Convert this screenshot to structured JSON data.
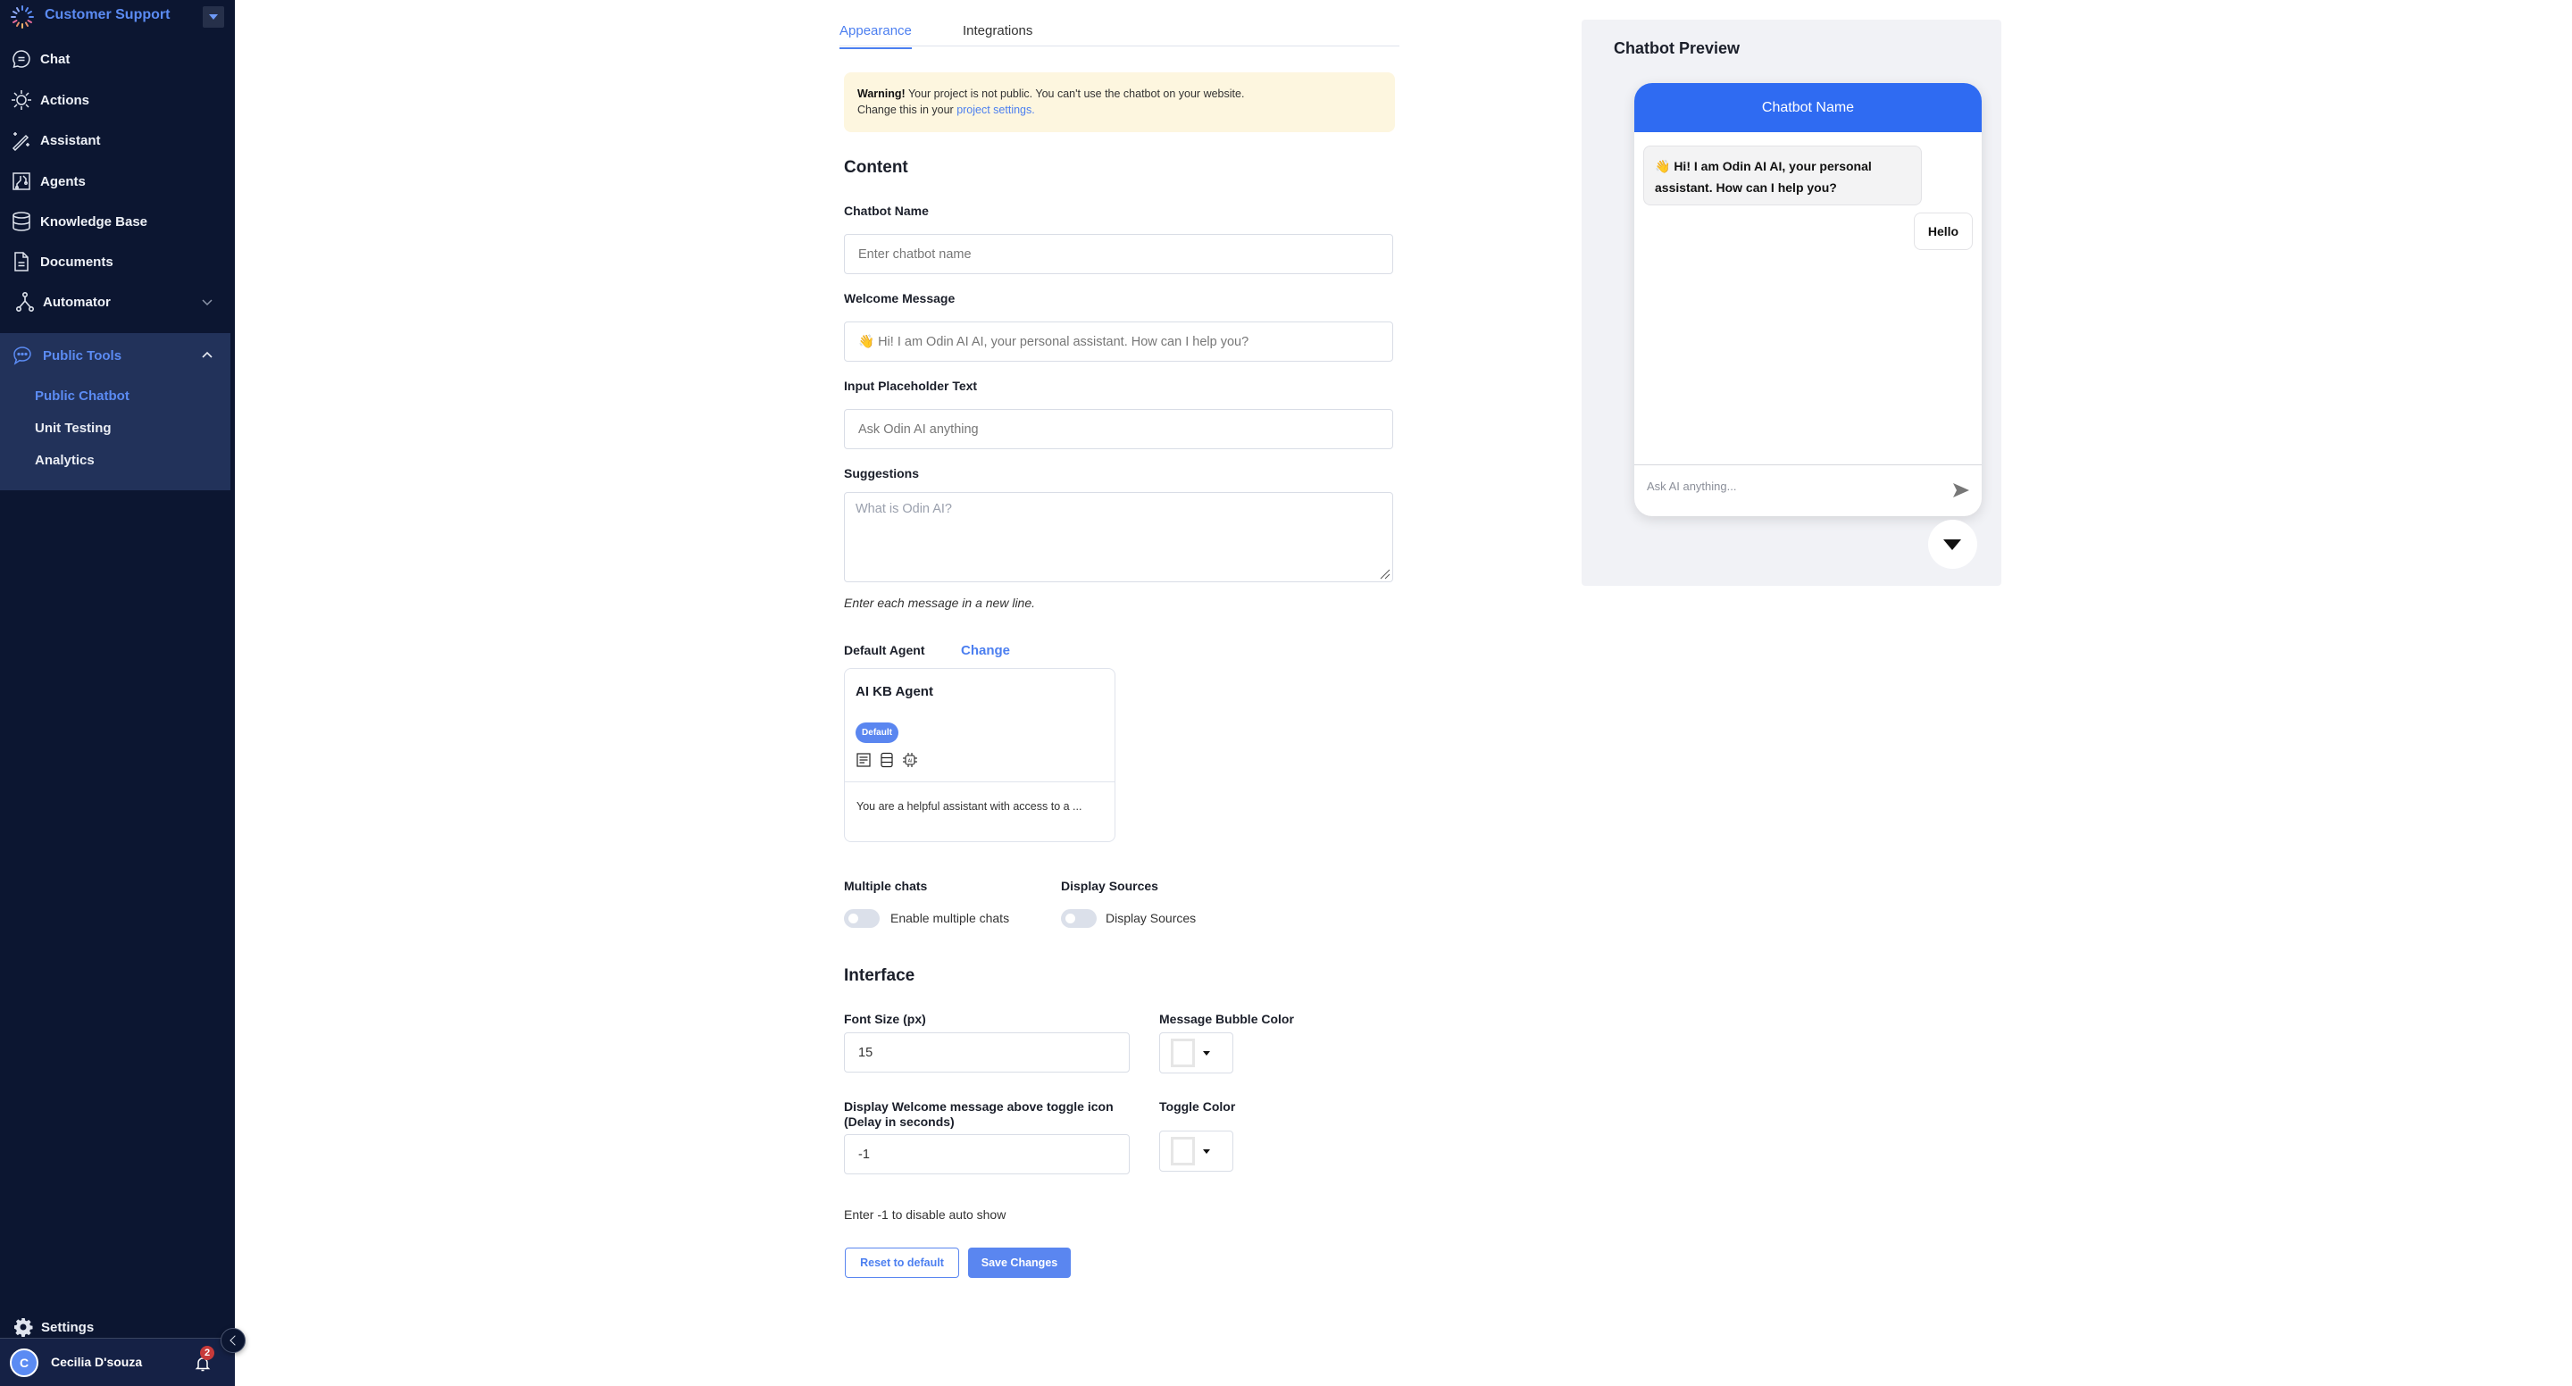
{
  "sidebar": {
    "project_name": "Customer Support",
    "nav": [
      {
        "label": "Chat",
        "icon": "chat-bubble-icon"
      },
      {
        "label": "Actions",
        "icon": "actions-sun-icon"
      },
      {
        "label": "Assistant",
        "icon": "magic-wand-icon"
      },
      {
        "label": "Agents",
        "icon": "agents-circuit-icon"
      },
      {
        "label": "Knowledge Base",
        "icon": "database-icon"
      },
      {
        "label": "Documents",
        "icon": "document-icon"
      },
      {
        "label": "Automator",
        "icon": "automator-nodes-icon"
      }
    ],
    "public_tools": {
      "label": "Public Tools",
      "items": [
        {
          "label": "Public Chatbot",
          "active": true
        },
        {
          "label": "Unit Testing",
          "active": false
        },
        {
          "label": "Analytics",
          "active": false
        }
      ]
    },
    "settings_label": "Settings",
    "user": {
      "initial": "C",
      "name": "Cecilia D'souza",
      "notifications": "2"
    }
  },
  "tabs": [
    {
      "label": "Appearance",
      "active": true
    },
    {
      "label": "Integrations",
      "active": false
    }
  ],
  "warning": {
    "bold": "Warning!",
    "text": " Your project is not public. You can't use the chatbot on your website.",
    "line2": "Change this in your ",
    "link": "project settings."
  },
  "content": {
    "heading": "Content",
    "chatbot_name": {
      "label": "Chatbot Name",
      "placeholder": "Enter chatbot name",
      "value": ""
    },
    "welcome_message": {
      "label": "Welcome Message",
      "value": "👋 Hi! I am Odin AI AI, your personal assistant. How can I help you?"
    },
    "input_placeholder": {
      "label": "Input Placeholder Text",
      "value": "Ask Odin AI anything"
    },
    "suggestions": {
      "label": "Suggestions",
      "placeholder": "What is Odin AI?",
      "hint": "Enter each message in a new line."
    },
    "default_agent": {
      "label": "Default Agent",
      "change_link": "Change",
      "name": "AI KB Agent",
      "badge": "Default",
      "icons": [
        "document-icon",
        "database-icon",
        "ai-chip-icon"
      ],
      "description": "You are a helpful assistant with access to a ..."
    },
    "multiple_chats": {
      "label": "Multiple chats",
      "toggle_label": "Enable multiple chats",
      "enabled": false
    },
    "display_sources": {
      "label": "Display Sources",
      "toggle_label": "Display Sources",
      "enabled": false
    }
  },
  "interface": {
    "heading": "Interface",
    "font_size": {
      "label": "Font Size (px)",
      "value": "15"
    },
    "message_bubble_color": {
      "label": "Message Bubble Color",
      "value": "#ffffff"
    },
    "welcome_delay": {
      "label": "Display Welcome message above toggle icon (Delay in seconds)",
      "value": "-1",
      "hint": "Enter -1 to disable auto show"
    },
    "toggle_color": {
      "label": "Toggle Color",
      "value": "#ffffff"
    }
  },
  "actions": {
    "reset": "Reset to default",
    "save": "Save Changes"
  },
  "preview": {
    "title": "Chatbot Preview",
    "chatbot_name": "Chatbot Name",
    "bot_message": "👋 Hi! I am Odin AI AI, your personal assistant. How can I help you?",
    "user_message": "Hello",
    "input_placeholder": "Ask AI anything...",
    "header_color": "#2f6bf2"
  },
  "colors": {
    "accent": "#5a86f0",
    "sidebar_bg": "#0c1631",
    "sidebar_section_bg": "#22325a",
    "warning_bg": "#fdf6df"
  }
}
